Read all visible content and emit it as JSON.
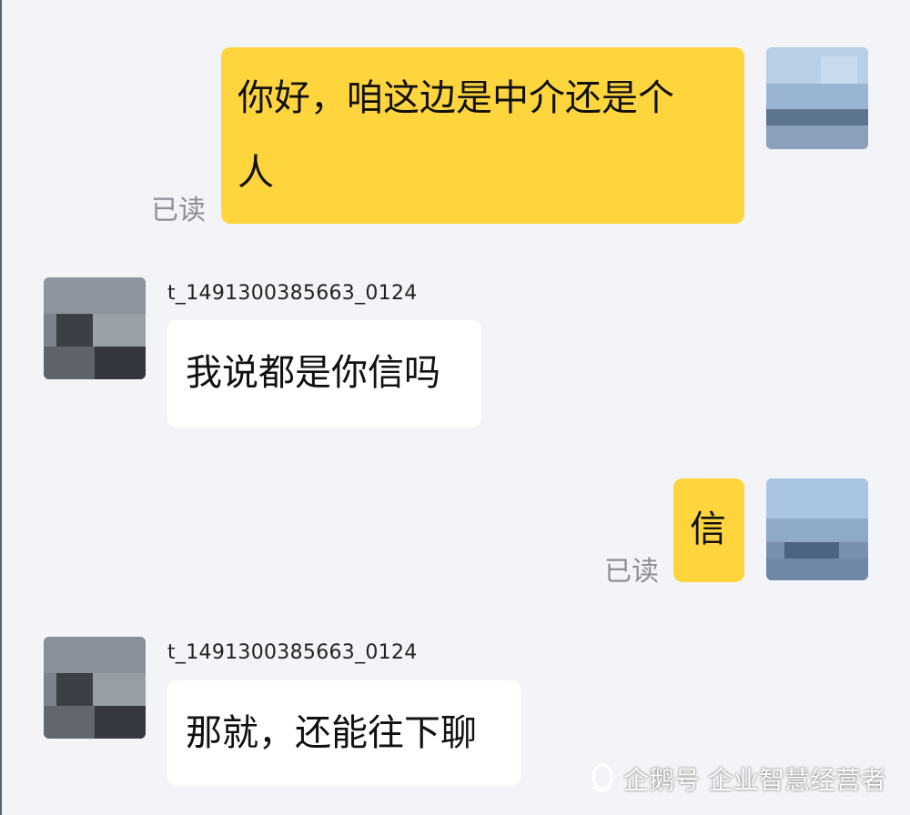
{
  "messages": [
    {
      "side": "self",
      "text": "你好，咱这边是中介还是个人",
      "line1": "你好，咱这边是中介还是个",
      "line2": "人",
      "status": "已读"
    },
    {
      "side": "other",
      "sender": "t_1491300385663_0124",
      "text": "我说都是你信吗"
    },
    {
      "side": "self",
      "text": "信",
      "status": "已读"
    },
    {
      "side": "other",
      "sender": "t_1491300385663_0124",
      "text": "那就，还能往下聊"
    }
  ],
  "watermark": {
    "text": "企鹅号 企业智慧经营者",
    "icon": "qq-penguin-icon"
  },
  "colors": {
    "background": "#f3f4f8",
    "self_bubble": "#ffd53e",
    "other_bubble": "#ffffff",
    "read_status": "#8c8f96"
  }
}
